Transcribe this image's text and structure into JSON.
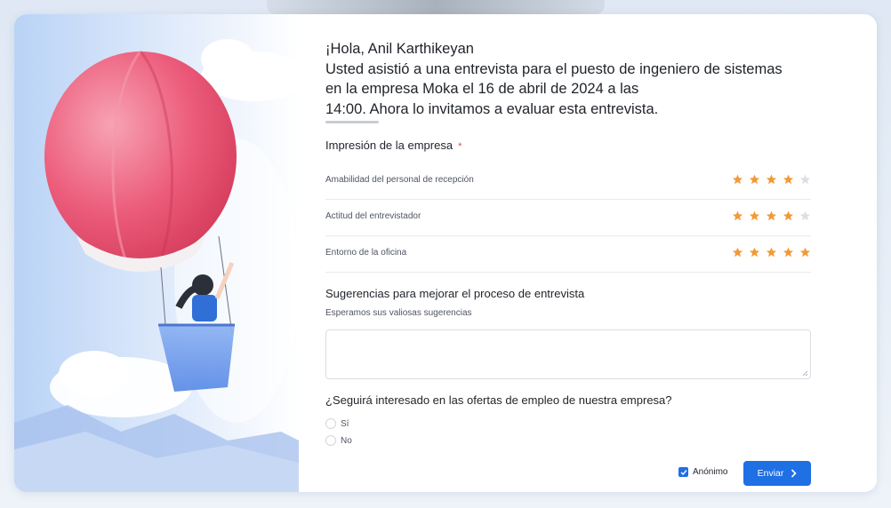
{
  "greeting": {
    "line1": "¡Hola, Anil Karthikeyan",
    "line2": "Usted asistió a una entrevista para el puesto de ingeniero de sistemas",
    "line3": "en la empresa Moka el 16 de abril de 2024 a las",
    "line4": "14:00. Ahora lo invitamos a evaluar esta entrevista."
  },
  "impression": {
    "title": "Impresión de la empresa",
    "required_mark": "*",
    "rows": [
      {
        "label": "Amabilidad del personal de recepción",
        "rating": 4,
        "max": 5
      },
      {
        "label": "Actitud del entrevistador",
        "rating": 4,
        "max": 5
      },
      {
        "label": "Entorno de la oficina",
        "rating": 5,
        "max": 5
      }
    ]
  },
  "suggestions": {
    "title": "Sugerencias para mejorar el proceso de entrevista",
    "hint": "Esperamos sus valiosas sugerencias",
    "value": ""
  },
  "interest": {
    "question": "¿Seguirá interesado en las ofertas de empleo de nuestra empresa?",
    "options": [
      "Sí",
      "No"
    ]
  },
  "footer": {
    "anonymous_label": "Anónimo",
    "anonymous_checked": true,
    "send_label": "Enviar"
  },
  "colors": {
    "accent": "#1f6fe5",
    "star_on": "#f29a38",
    "star_off": "#dcdfe4"
  }
}
